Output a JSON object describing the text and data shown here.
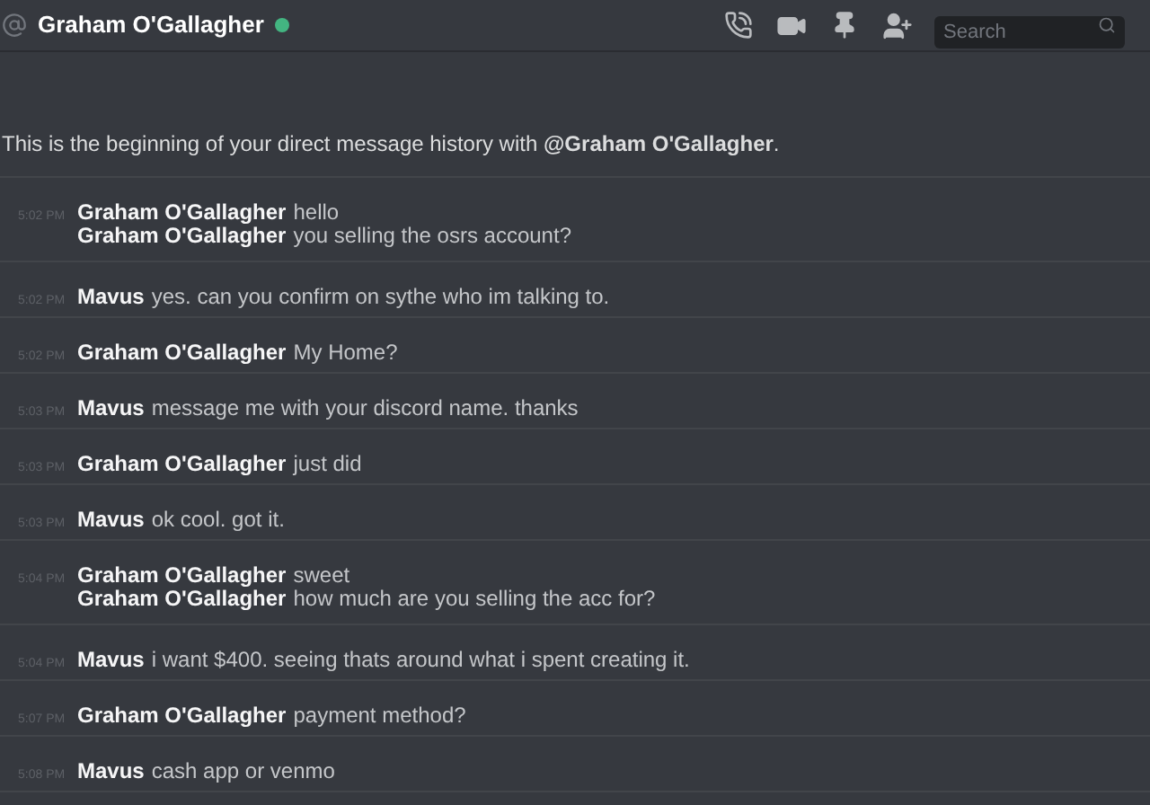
{
  "header": {
    "title": "Graham O'Gallagher",
    "online": true,
    "search": {
      "placeholder": "Search"
    }
  },
  "intro": "This is the beginning of your direct message history with **@Graham O'Gallagher**.",
  "groups": [
    {
      "time": "5:02 PM",
      "lines": [
        {
          "author": "Graham O'Gallagher",
          "text": "hello"
        },
        {
          "author": "Graham O'Gallagher",
          "text": "you selling the osrs account?"
        }
      ]
    },
    {
      "time": "5:02 PM",
      "lines": [
        {
          "author": "Mavus",
          "text": "yes. can you confirm on sythe who im talking to."
        }
      ]
    },
    {
      "time": "5:02 PM",
      "lines": [
        {
          "author": "Graham O'Gallagher",
          "text": "My Home?"
        }
      ]
    },
    {
      "time": "5:03 PM",
      "lines": [
        {
          "author": "Mavus",
          "text": "message me with your discord name. thanks"
        }
      ]
    },
    {
      "time": "5:03 PM",
      "lines": [
        {
          "author": "Graham O'Gallagher",
          "text": "just did"
        }
      ]
    },
    {
      "time": "5:03 PM",
      "lines": [
        {
          "author": "Mavus",
          "text": "ok cool. got it."
        }
      ]
    },
    {
      "time": "5:04 PM",
      "lines": [
        {
          "author": "Graham O'Gallagher",
          "text": "sweet"
        },
        {
          "author": "Graham O'Gallagher",
          "text": "how much are you selling the acc for?"
        }
      ]
    },
    {
      "time": "5:04 PM",
      "lines": [
        {
          "author": "Mavus",
          "text": "i want $400. seeing thats around what i spent creating it."
        }
      ]
    },
    {
      "time": "5:07 PM",
      "lines": [
        {
          "author": "Graham O'Gallagher",
          "text": "payment method?"
        }
      ]
    },
    {
      "time": "5:08 PM",
      "lines": [
        {
          "author": "Mavus",
          "text": "cash app or venmo"
        }
      ]
    }
  ]
}
